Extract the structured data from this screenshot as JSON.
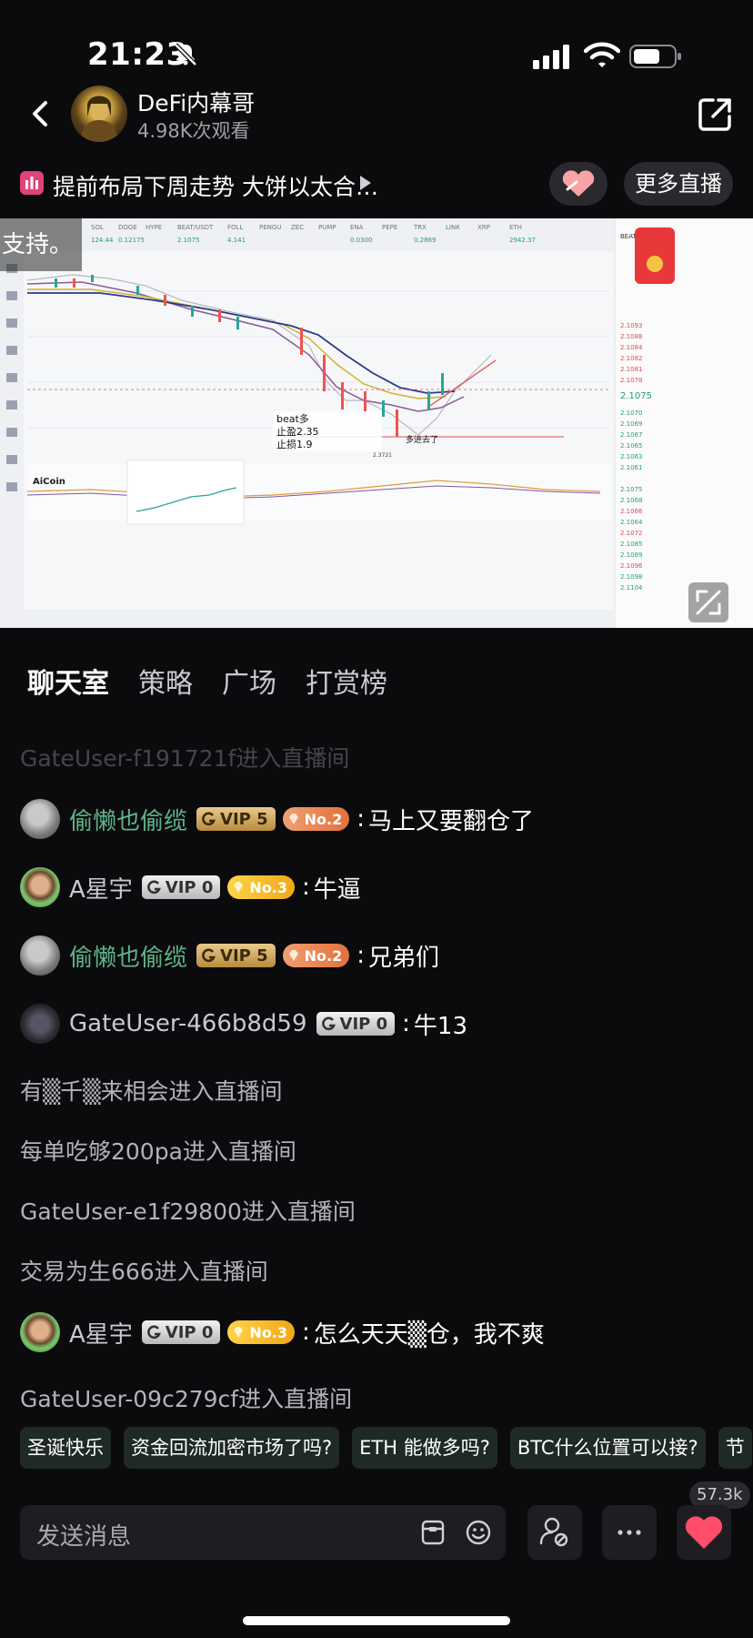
{
  "status_bar": {
    "time": "21:23"
  },
  "header": {
    "host_name": "DeFi内幕哥",
    "views": "4.98K次观看"
  },
  "stream": {
    "title": "提前布局下周走势 大饼以太合…",
    "more_live_label": "更多直播",
    "subtitle": "支持。"
  },
  "tabs": [
    {
      "label": "聊天室"
    },
    {
      "label": "策略"
    },
    {
      "label": "广场"
    },
    {
      "label": "打赏榜"
    }
  ],
  "chat": {
    "faded_system": "GateUser-f191721f进入直播间",
    "messages": [
      {
        "user": "偷懒也偷缆",
        "vip": "VIP 5",
        "rank": "No.2",
        "text": "马上又要翻仓了"
      },
      {
        "user": "A星宇",
        "vip": "VIP 0",
        "rank": "No.3",
        "text": "牛逼"
      },
      {
        "user": "偷懒也偷缆",
        "vip": "VIP 5",
        "rank": "No.2",
        "text": "兄弟们"
      },
      {
        "user": "GateUser-466b8d59",
        "vip": "VIP 0",
        "text": "牛13"
      },
      {
        "user": "A星宇",
        "vip": "VIP 0",
        "rank": "No.3",
        "text": "怎么天天▒仓，我不爽"
      }
    ],
    "system": [
      "有▒千▒来相会进入直播间",
      "每单吃够200pa进入直播间",
      "GateUser-e1f29800进入直播间",
      "交易为生666进入直播间",
      "GateUser-09c279cf进入直播间"
    ]
  },
  "video_chart": {
    "annotation_title": "beat多",
    "take_profit": "止盈2.35",
    "stop_loss": "止损1.9",
    "arrow_note": "多进去了",
    "low_price": "2.3721",
    "watermark": "AiCoin"
  },
  "quick_replies": [
    "圣诞快乐",
    "资金回流加密市场了吗?",
    "ETH 能做多吗?",
    "BTC什么位置可以接?",
    "节"
  ],
  "bottom_bar": {
    "input_placeholder": "发送消息",
    "like_count": "57.3k"
  },
  "colors": {
    "background": "#0b0b0d",
    "vip_gold": "#d4aa5e",
    "rank_orange": "#e2703c",
    "rank_yellow": "#f0a818",
    "username_green": "#5fb489",
    "like_red": "#ff4d6a"
  }
}
